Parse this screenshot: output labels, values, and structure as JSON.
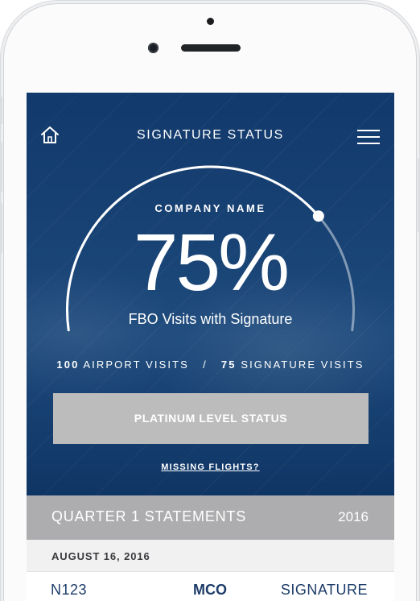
{
  "header": {
    "title": "SIGNATURE STATUS",
    "home_icon": "home-icon",
    "menu_icon": "hamburger-menu-icon"
  },
  "summary": {
    "company_name": "COMPANY NAME",
    "percent_display": "75%",
    "percent_value": 0.75,
    "percent_label": "FBO Visits with Signature",
    "airport_visits_count": "100",
    "airport_visits_label": "AIRPORT VISITS",
    "separator": "/",
    "signature_visits_count": "75",
    "signature_visits_label": "SIGNATURE VISITS"
  },
  "status_button": {
    "label": "PLATINUM LEVEL STATUS"
  },
  "missing_flights_link": {
    "label": "MISSING FLIGHTS?"
  },
  "statements": {
    "title": "QUARTER 1 STATEMENTS",
    "year": "2016",
    "date": "AUGUST 16, 2016",
    "rows": [
      {
        "tail": "N123",
        "airport": "MCO",
        "fbo": "SIGNATURE"
      }
    ]
  },
  "colors": {
    "accent_blue": "#1d4a7c",
    "button_gray": "#bcbcbc",
    "section_gray": "#adadaf",
    "row_text": "#1d3c69"
  }
}
